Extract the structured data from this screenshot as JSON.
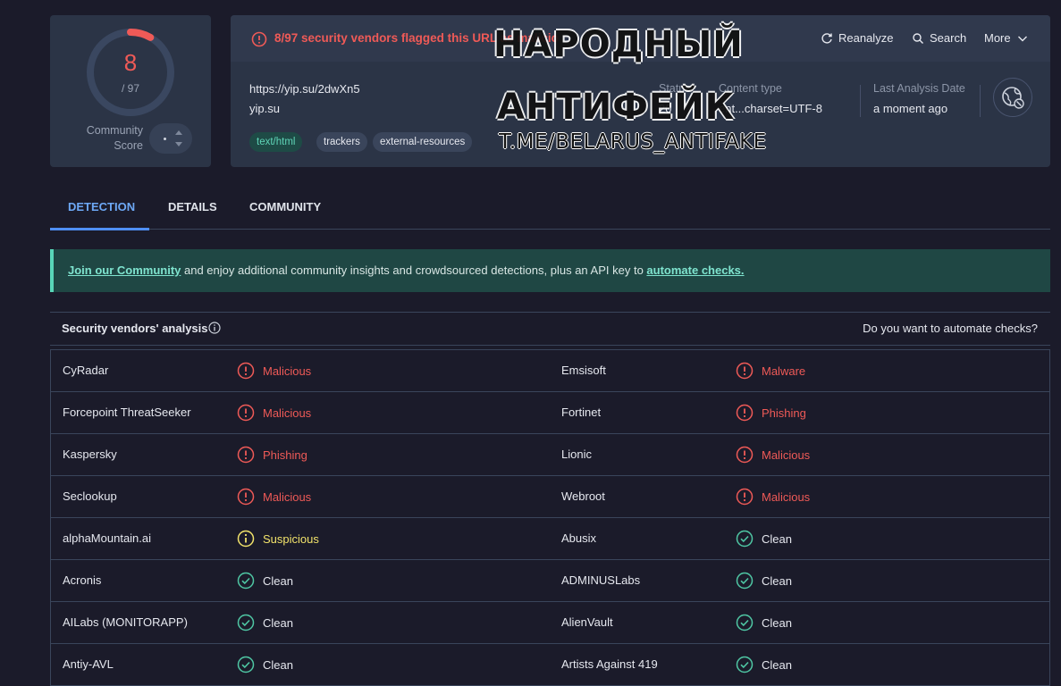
{
  "score": {
    "value": "8",
    "total": "/ 97",
    "label_line1": "Community",
    "label_line2": "Score",
    "flagged_fraction": 0.0825
  },
  "summary": {
    "flag_text": "8/97 security vendors flagged this URL as malicio",
    "actions": {
      "reanalyze": "Reanalyze",
      "search": "Search",
      "more": "More"
    },
    "url": "https://yip.su/2dwXn5",
    "domain": "yip.su",
    "tags": [
      "text/html",
      "trackers",
      "external-resources"
    ],
    "status_label": "Status",
    "status_value": "20",
    "content_type_label": "Content type",
    "content_type_value": "ent...charset=UTF-8",
    "last_analysis_label": "Last Analysis Date",
    "last_analysis_value": "a moment ago"
  },
  "watermark": {
    "line1": "НАРОДНЫЙ",
    "line2": "АНТИФЕЙК",
    "line3": "T.ME/BELARUS_ANTIFAKE"
  },
  "tabs": [
    "DETECTION",
    "DETAILS",
    "COMMUNITY"
  ],
  "banner": {
    "link1": "Join our Community",
    "middle": " and enjoy additional community insights and crowdsourced detections, plus an API key to ",
    "link2": "automate checks."
  },
  "vendors": {
    "title": "Security vendors' analysis",
    "automate_question": "Do you want to automate checks?",
    "rows": [
      [
        {
          "name": "CyRadar",
          "result": "Malicious",
          "kind": "malicious"
        },
        {
          "name": "Emsisoft",
          "result": "Malware",
          "kind": "malicious"
        }
      ],
      [
        {
          "name": "Forcepoint ThreatSeeker",
          "result": "Malicious",
          "kind": "malicious"
        },
        {
          "name": "Fortinet",
          "result": "Phishing",
          "kind": "malicious"
        }
      ],
      [
        {
          "name": "Kaspersky",
          "result": "Phishing",
          "kind": "malicious"
        },
        {
          "name": "Lionic",
          "result": "Malicious",
          "kind": "malicious"
        }
      ],
      [
        {
          "name": "Seclookup",
          "result": "Malicious",
          "kind": "malicious"
        },
        {
          "name": "Webroot",
          "result": "Malicious",
          "kind": "malicious"
        }
      ],
      [
        {
          "name": "alphaMountain.ai",
          "result": "Suspicious",
          "kind": "suspicious"
        },
        {
          "name": "Abusix",
          "result": "Clean",
          "kind": "clean"
        }
      ],
      [
        {
          "name": "Acronis",
          "result": "Clean",
          "kind": "clean"
        },
        {
          "name": "ADMINUSLabs",
          "result": "Clean",
          "kind": "clean"
        }
      ],
      [
        {
          "name": "AILabs (MONITORAPP)",
          "result": "Clean",
          "kind": "clean"
        },
        {
          "name": "AlienVault",
          "result": "Clean",
          "kind": "clean"
        }
      ],
      [
        {
          "name": "Antiy-AVL",
          "result": "Clean",
          "kind": "clean"
        },
        {
          "name": "Artists Against 419",
          "result": "Clean",
          "kind": "clean"
        }
      ]
    ]
  },
  "colors": {
    "malicious": "#ef5a57",
    "suspicious": "#f2e36b",
    "clean": "#4fc7a4",
    "accent": "#4f8ff7"
  }
}
